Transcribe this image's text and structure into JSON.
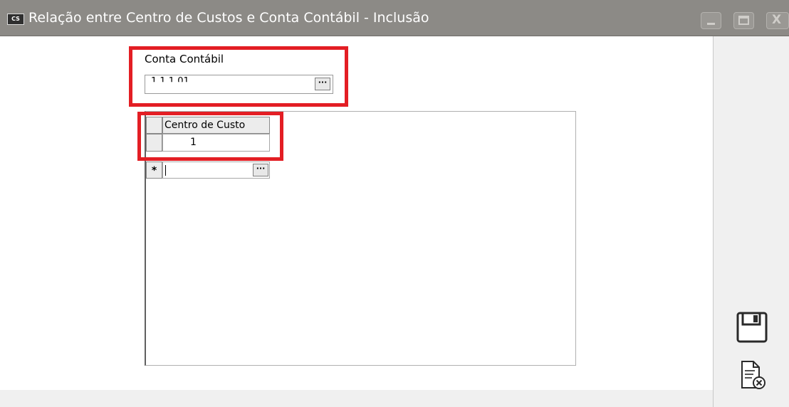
{
  "window": {
    "title": "Relação entre Centro de Custos e Conta Contábil - Inclusão",
    "app_icon_text": "CS",
    "minimize_glyph": "_",
    "maximize_glyph": "□",
    "close_glyph": "X"
  },
  "form": {
    "conta_label": "Conta Contábil",
    "conta_value": "1.1.1.01",
    "lookup_glyph": "···"
  },
  "grid": {
    "column_header": "Centro de Custo",
    "rows": [
      {
        "value": "1"
      }
    ],
    "new_row_marker": "*",
    "lookup_glyph": "···"
  },
  "side_actions": {
    "save_icon": "floppy-disk-icon",
    "cancel_icon": "document-cancel-icon"
  },
  "colors": {
    "titlebar": "#8c8a86",
    "highlight": "#e31e24",
    "panel": "#f0f0f0"
  }
}
